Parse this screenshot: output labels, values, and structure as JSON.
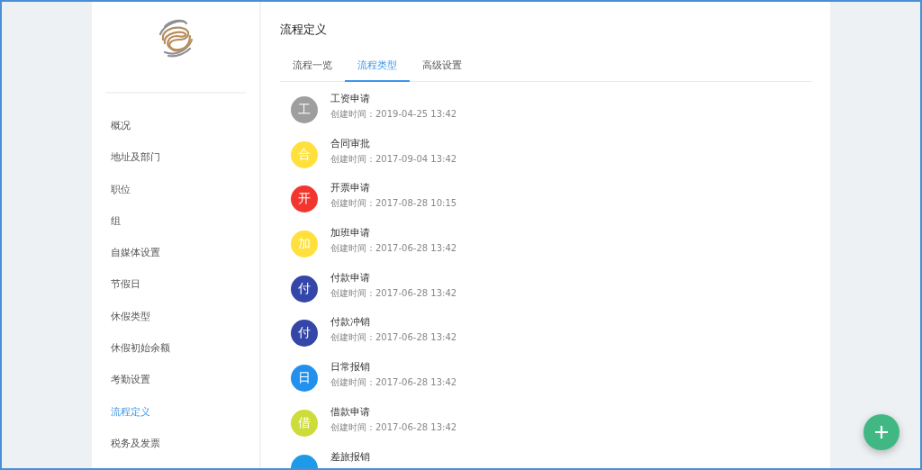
{
  "sidebar": {
    "items": [
      {
        "label": "概况",
        "selected": false
      },
      {
        "label": "地址及部门",
        "selected": false
      },
      {
        "label": "职位",
        "selected": false
      },
      {
        "label": "组",
        "selected": false
      },
      {
        "label": "自媒体设置",
        "selected": false
      },
      {
        "label": "节假日",
        "selected": false
      },
      {
        "label": "休假类型",
        "selected": false
      },
      {
        "label": "休假初始余额",
        "selected": false
      },
      {
        "label": "考勤设置",
        "selected": false
      },
      {
        "label": "流程定义",
        "selected": true
      },
      {
        "label": "税务及发票",
        "selected": false
      }
    ]
  },
  "page": {
    "title": "流程定义"
  },
  "tabs": [
    {
      "label": "流程一览",
      "selected": false
    },
    {
      "label": "流程类型",
      "selected": true
    },
    {
      "label": "高级设置",
      "selected": false
    }
  ],
  "flows": [
    {
      "avatar": "工",
      "color": "#9e9e9e",
      "name": "工资申请",
      "created": "创建时间：2019-04-25 13:42"
    },
    {
      "avatar": "合",
      "color": "#ffe03d",
      "name": "合同审批",
      "created": "创建时间：2017-09-04 13:42"
    },
    {
      "avatar": "开",
      "color": "#f2362f",
      "name": "开票申请",
      "created": "创建时间：2017-08-28 10:15"
    },
    {
      "avatar": "加",
      "color": "#ffe03d",
      "name": "加班申请",
      "created": "创建时间：2017-06-28 13:42"
    },
    {
      "avatar": "付",
      "color": "#3446a8",
      "name": "付款申请",
      "created": "创建时间：2017-06-28 13:42"
    },
    {
      "avatar": "付",
      "color": "#3446a8",
      "name": "付款冲销",
      "created": "创建时间：2017-06-28 13:42"
    },
    {
      "avatar": "日",
      "color": "#2291ee",
      "name": "日常报销",
      "created": "创建时间：2017-06-28 13:42"
    },
    {
      "avatar": "借",
      "color": "#cddc39",
      "name": "借款申请",
      "created": "创建时间：2017-06-28 13:42"
    },
    {
      "color": "#1e9be8",
      "name": "差旅报销"
    }
  ]
}
